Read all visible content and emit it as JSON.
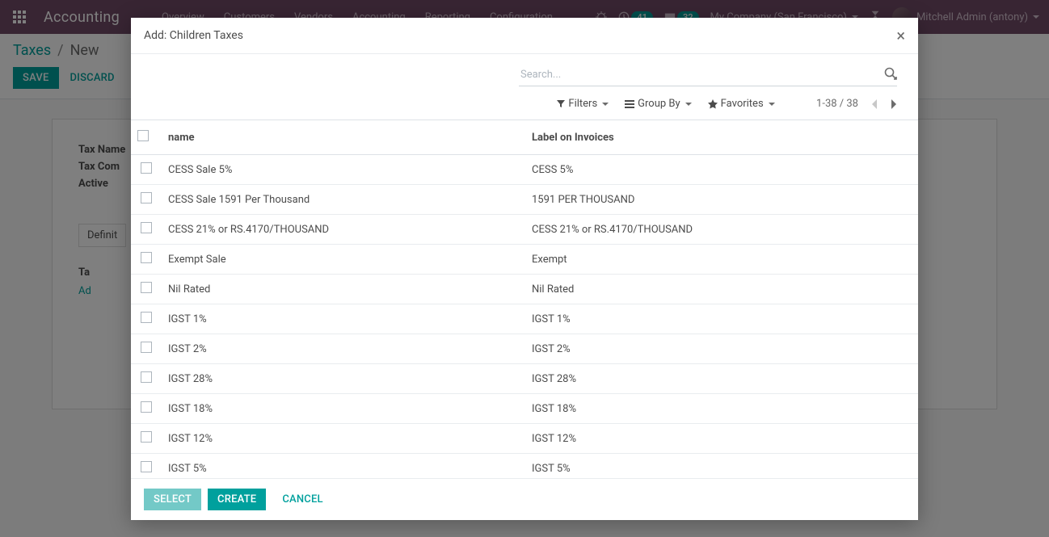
{
  "topbar": {
    "app_name": "Accounting",
    "menu": [
      "Overview",
      "Customers",
      "Vendors",
      "Accounting",
      "Reporting",
      "Configuration"
    ],
    "badge_clock": "41",
    "badge_chat": "32",
    "company": "My Company (San Francisco)",
    "user": "Mitchell Admin (antony)"
  },
  "breadcrumb": {
    "root": "Taxes",
    "current": "New"
  },
  "actions": {
    "save": "SAVE",
    "discard": "DISCARD"
  },
  "background_form": {
    "tax_name": "Tax Name",
    "tax_comp": "Tax Com",
    "active": "Active",
    "tab": "Definit",
    "sub": "Ta",
    "add": "Ad"
  },
  "modal": {
    "title": "Add: Children Taxes",
    "search_placeholder": "Search...",
    "filters": "Filters",
    "group_by": "Group By",
    "favorites": "Favorites",
    "pager": "1-38 / 38",
    "columns": {
      "name": "name",
      "label": "Label on Invoices"
    },
    "rows": [
      {
        "name": "CESS Sale 5%",
        "label": "CESS 5%"
      },
      {
        "name": "CESS Sale 1591 Per Thousand",
        "label": "1591 PER THOUSAND"
      },
      {
        "name": "CESS 21% or RS.4170/THOUSAND",
        "label": "CESS 21% or RS.4170/THOUSAND"
      },
      {
        "name": "Exempt Sale",
        "label": "Exempt"
      },
      {
        "name": "Nil Rated",
        "label": "Nil Rated"
      },
      {
        "name": "IGST 1%",
        "label": "IGST 1%"
      },
      {
        "name": "IGST 2%",
        "label": "IGST 2%"
      },
      {
        "name": "IGST 28%",
        "label": "IGST 28%"
      },
      {
        "name": "IGST 18%",
        "label": "IGST 18%"
      },
      {
        "name": "IGST 12%",
        "label": "IGST 12%"
      },
      {
        "name": "IGST 5%",
        "label": "IGST 5%"
      }
    ],
    "footer": {
      "select": "SELECT",
      "create": "CREATE",
      "cancel": "CANCEL"
    }
  }
}
